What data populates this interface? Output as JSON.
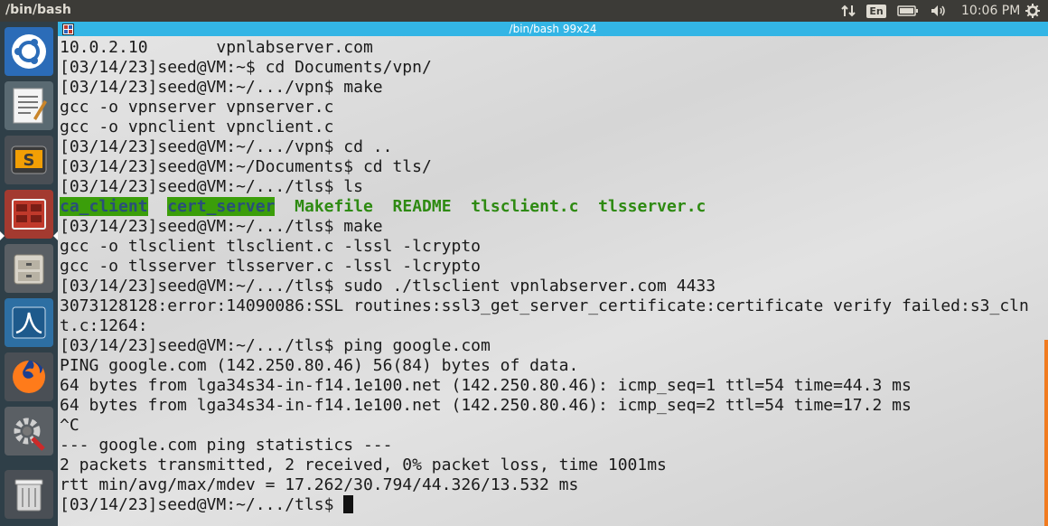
{
  "top_panel": {
    "app_title": "/bin/bash",
    "language": "En",
    "clock": "10:06 PM"
  },
  "launcher": {
    "items": [
      {
        "name": "ubuntu-dash",
        "icon": "ubuntu-logo-icon"
      },
      {
        "name": "text-editor",
        "icon": "text-editor-icon"
      },
      {
        "name": "sublime-text",
        "icon": "sublime-icon"
      },
      {
        "name": "terminal",
        "icon": "terminal-icon",
        "active": true
      },
      {
        "name": "file-manager",
        "icon": "files-icon"
      },
      {
        "name": "wireshark",
        "icon": "wireshark-icon"
      },
      {
        "name": "firefox",
        "icon": "firefox-icon"
      },
      {
        "name": "system-settings",
        "icon": "settings-icon"
      },
      {
        "name": "trash",
        "icon": "trash-icon"
      }
    ]
  },
  "terminal": {
    "title": "/bin/bash 99x24",
    "lines": [
      "10.0.2.10       vpnlabserver.com",
      "[03/14/23]seed@VM:~$ cd Documents/vpn/",
      "[03/14/23]seed@VM:~/.../vpn$ make",
      "gcc -o vpnserver vpnserver.c",
      "gcc -o vpnclient vpnclient.c",
      "[03/14/23]seed@VM:~/.../vpn$ cd ..",
      "[03/14/23]seed@VM:~/Documents$ cd tls/",
      "[03/14/23]seed@VM:~/.../tls$ ls",
      "",
      "[03/14/23]seed@VM:~/.../tls$ make",
      "gcc -o tlsclient tlsclient.c -lssl -lcrypto",
      "gcc -o tlsserver tlsserver.c -lssl -lcrypto",
      "[03/14/23]seed@VM:~/.../tls$ sudo ./tlsclient vpnlabserver.com 4433",
      "3073128128:error:14090086:SSL routines:ssl3_get_server_certificate:certificate verify failed:s3_cln",
      "t.c:1264:",
      "[03/14/23]seed@VM:~/.../tls$ ping google.com",
      "PING google.com (142.250.80.46) 56(84) bytes of data.",
      "64 bytes from lga34s34-in-f14.1e100.net (142.250.80.46): icmp_seq=1 ttl=54 time=44.3 ms",
      "64 bytes from lga34s34-in-f14.1e100.net (142.250.80.46): icmp_seq=2 ttl=54 time=17.2 ms",
      "^C",
      "--- google.com ping statistics ---",
      "2 packets transmitted, 2 received, 0% packet loss, time 1001ms",
      "rtt min/avg/max/mdev = 17.262/30.794/44.326/13.532 ms",
      "[03/14/23]seed@VM:~/.../tls$ "
    ],
    "ls_output": [
      "ca_client",
      "cert_server",
      "Makefile",
      "README",
      "tlsclient.c",
      "tlsserver.c"
    ],
    "ls_dirs": [
      "ca_client",
      "cert_server"
    ]
  },
  "colors": {
    "panel_bg": "#3c3b37",
    "launcher_bg": "#2f3f48",
    "titlebar": "#33b5e5",
    "ls_green": "#2e8a12",
    "dir_highlight": "#3b9e0a",
    "scroll_indicator": "#f07b20"
  }
}
